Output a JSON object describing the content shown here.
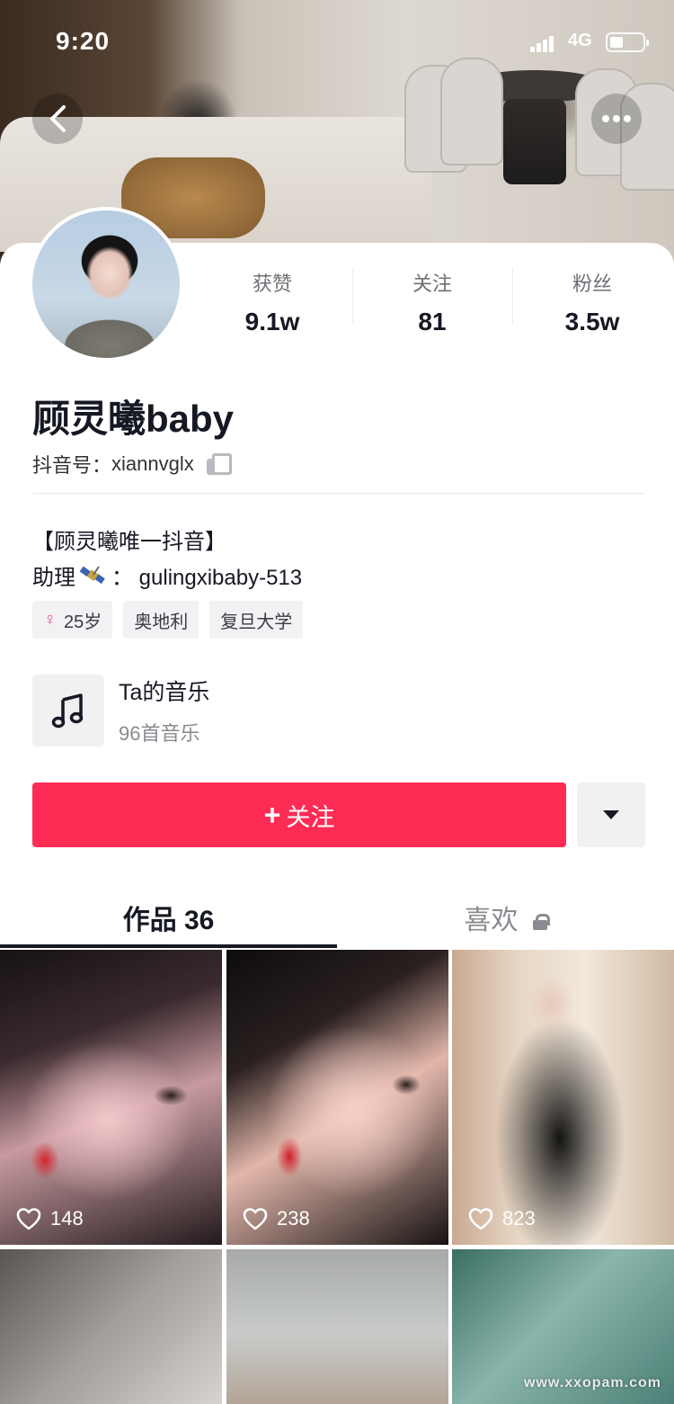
{
  "status_bar": {
    "time": "9:20",
    "network": "4G"
  },
  "profile": {
    "display_name": "顾灵曦baby",
    "handle_label": "抖音号：",
    "handle": "xiannvglx",
    "stats": [
      {
        "label": "获赞",
        "value": "9.1w"
      },
      {
        "label": "关注",
        "value": "81"
      },
      {
        "label": "粉丝",
        "value": "3.5w"
      }
    ],
    "bio_line1": "【顾灵曦唯一抖音】",
    "bio_line2_prefix": "助理",
    "bio_line2_suffix": "：  gulingxibaby-513",
    "tags": [
      {
        "icon": "female-icon",
        "label": "25岁"
      },
      {
        "label": "奥地利"
      },
      {
        "label": "复旦大学"
      }
    ]
  },
  "music": {
    "title": "Ta的音乐",
    "subtitle": "96首音乐"
  },
  "actions": {
    "follow_label": "关注"
  },
  "tabs": [
    {
      "label": "作品 36",
      "active": true
    },
    {
      "label": "喜欢",
      "locked": true,
      "active": false
    }
  ],
  "videos": [
    {
      "likes": "148"
    },
    {
      "likes": "238"
    },
    {
      "likes": "823"
    },
    {
      "likes": ""
    },
    {
      "likes": ""
    },
    {
      "likes": ""
    }
  ],
  "watermark": "www.xxopam.com",
  "colors": {
    "accent": "#fe2c55",
    "female_tag": "#f6508c",
    "text_primary": "#161823",
    "text_secondary": "#8a8b91"
  }
}
